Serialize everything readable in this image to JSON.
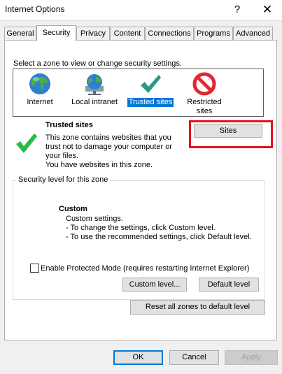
{
  "window": {
    "title": "Internet Options",
    "help_glyph": "?",
    "close_glyph": "✕"
  },
  "tabs": [
    {
      "label": "General"
    },
    {
      "label": "Security"
    },
    {
      "label": "Privacy"
    },
    {
      "label": "Content"
    },
    {
      "label": "Connections"
    },
    {
      "label": "Programs"
    },
    {
      "label": "Advanced"
    }
  ],
  "active_tab": "Security",
  "zones": {
    "prompt": "Select a zone to view or change security settings.",
    "items": [
      {
        "label": "Internet",
        "icon": "globe-icon"
      },
      {
        "label": "Local intranet",
        "icon": "network-globe-icon"
      },
      {
        "label": "Trusted sites",
        "icon": "check-icon"
      },
      {
        "label": "Restricted sites",
        "icon": "prohibited-icon"
      }
    ],
    "selected": "Trusted sites"
  },
  "zone_info": {
    "title": "Trusted sites",
    "desc_lines": [
      "This zone contains websites that you",
      "trust not to damage your computer or",
      "your files.",
      "You have websites in this zone."
    ],
    "sites_button": "Sites"
  },
  "security_level": {
    "group_title": "Security level for this zone",
    "level_title": "Custom",
    "lines": [
      "Custom settings.",
      "- To change the settings, click Custom level.",
      "- To use the recommended settings, click Default level."
    ]
  },
  "protected_mode": {
    "label": "Enable Protected Mode (requires restarting Internet Explorer)",
    "checked": false
  },
  "buttons": {
    "custom_level": "Custom level...",
    "default_level": "Default level",
    "reset_all": "Reset all zones to default level",
    "ok": "OK",
    "cancel": "Cancel",
    "apply": "Apply"
  },
  "colors": {
    "accent": "#0078d7",
    "highlight_box": "#e81123",
    "check_green": "#2db84d",
    "prohibited_red": "#e3262f"
  }
}
